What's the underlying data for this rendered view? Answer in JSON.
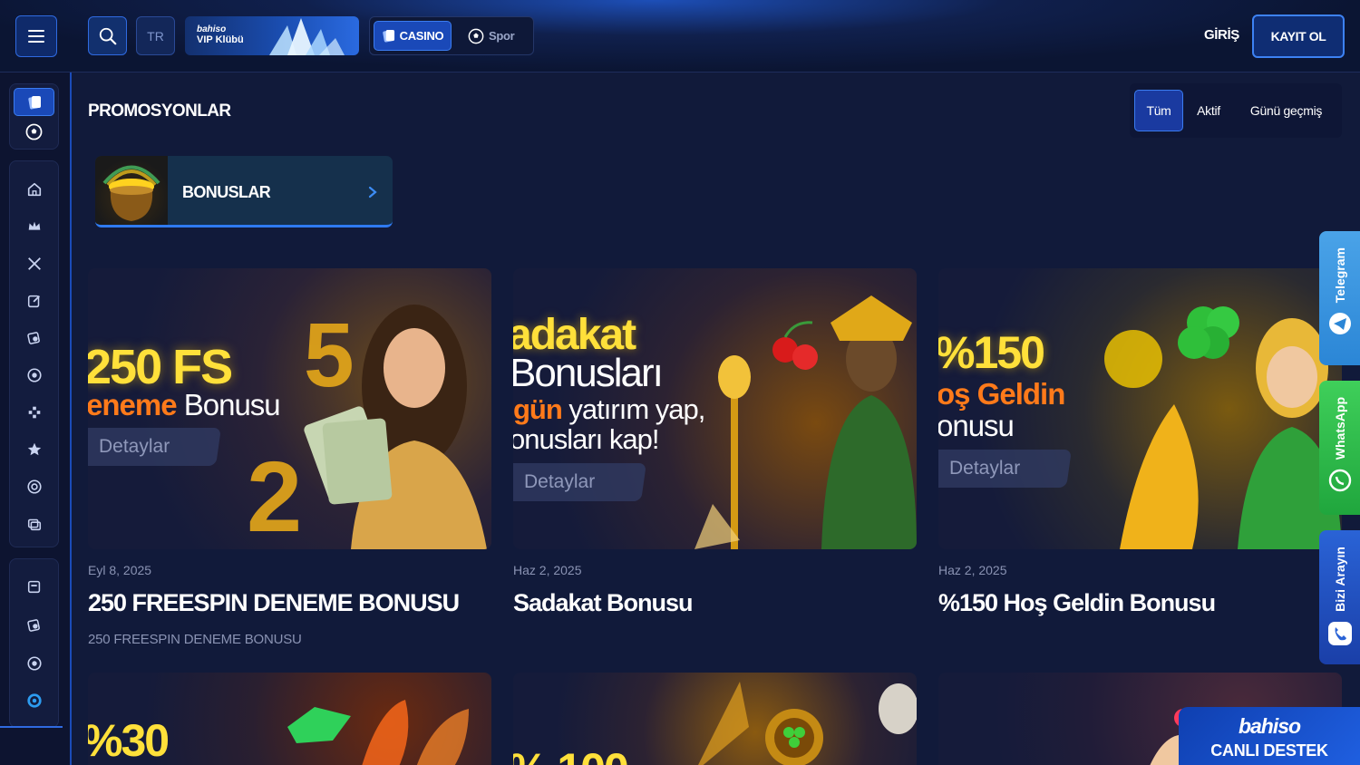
{
  "header": {
    "language": "TR",
    "vip_brand": "bahiso",
    "vip_label": "VIP Klübü",
    "casino_label": "CASINO",
    "spor_label": "Spor",
    "login_label": "GİRİŞ",
    "register_label": "KAYIT OL"
  },
  "page": {
    "title": "PROMOSYONLAR",
    "filters": [
      "Tüm",
      "Aktif",
      "Günü geçmiş"
    ],
    "active_filter": "Tüm"
  },
  "category": {
    "label": "BONUSLAR"
  },
  "promos": [
    {
      "banner_line1": "250 FS",
      "banner_line2_accent": "eneme",
      "banner_line2_rest": " Bonusu",
      "button": "Detaylar",
      "date": "Eyl 8, 2025",
      "title": "250 FREESPIN DENEME BONUSU",
      "subtitle": "250 FREESPIN DENEME BONUSU"
    },
    {
      "banner_line1": "adakat",
      "banner_line2": "Bonusları",
      "banner_line3_accent": "gün",
      "banner_line3_rest": " yatırım yap,",
      "banner_line4": "onusları kap!",
      "button": "Detaylar",
      "date": "Haz 2, 2025",
      "title": "Sadakat Bonusu"
    },
    {
      "banner_line1": "%150",
      "banner_line2": "oş Geldin",
      "banner_line3": "onusu",
      "button": "Detaylar",
      "date": "Haz 2, 2025",
      "title": "%150 Hoş Geldin Bonusu"
    }
  ],
  "row2": [
    {
      "banner_line1": "%30"
    },
    {
      "banner_line1": "% 100"
    },
    {
      "banner_line1": ""
    }
  ],
  "floating": {
    "telegram": "Telegram",
    "whatsapp": "WhatsApp",
    "call": "Bizi Arayın"
  },
  "live_support": {
    "brand": "bahiso",
    "label": "CANLI DESTEK"
  },
  "colors": {
    "accent": "#2f6ae0",
    "background": "#111a3a",
    "orange": "#ff7a1a",
    "gold": "#ffd21f"
  }
}
